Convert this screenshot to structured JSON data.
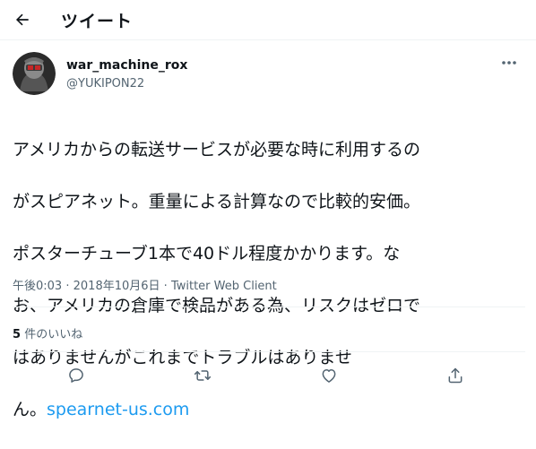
{
  "header": {
    "title": "ツイート",
    "back_icon": "arrow-left-icon"
  },
  "tweet": {
    "display_name": "war_machine_rox",
    "handle": "@YUKIPON22",
    "more_icon": "more-horizontal-icon",
    "lines": [
      "アメリカからの転送サービスが必要な時に利用するの",
      "がスピアネット。重量による計算なので比較的安価。",
      "ポスターチューブ1本で40ドル程度かかります。な",
      "お、アメリカの倉庫で検品がある為、リスクはゼロで",
      "はありませんがこれまでトラブルはありませ"
    ],
    "last_line_prefix": "ん。",
    "link": "spearnet-us.com",
    "time": "午後0:03",
    "separator": "·",
    "date": "2018年10月6日",
    "source": "Twitter Web Client",
    "likes_count": "5",
    "likes_label": "件のいいね"
  },
  "actions": [
    {
      "icon": "reply-icon"
    },
    {
      "icon": "retweet-icon"
    },
    {
      "icon": "like-icon"
    },
    {
      "icon": "share-icon"
    }
  ],
  "colors": {
    "link": "#1d9bf0",
    "muted": "#536471",
    "text": "#0f1419",
    "border": "#eff3f4"
  }
}
